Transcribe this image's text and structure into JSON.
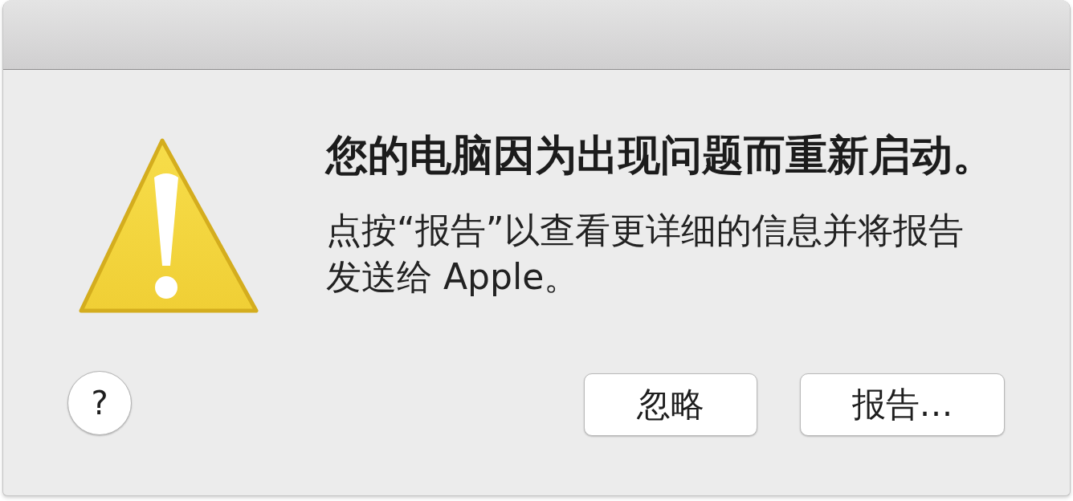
{
  "alert": {
    "title": "您的电脑因为出现问题而重新启动。",
    "message": "点按“报告”以查看更详细的信息并将报告发送给 Apple。"
  },
  "help_button": {
    "label": "?"
  },
  "buttons": [
    {
      "label": "忽略"
    },
    {
      "label": "报告…"
    }
  ]
}
